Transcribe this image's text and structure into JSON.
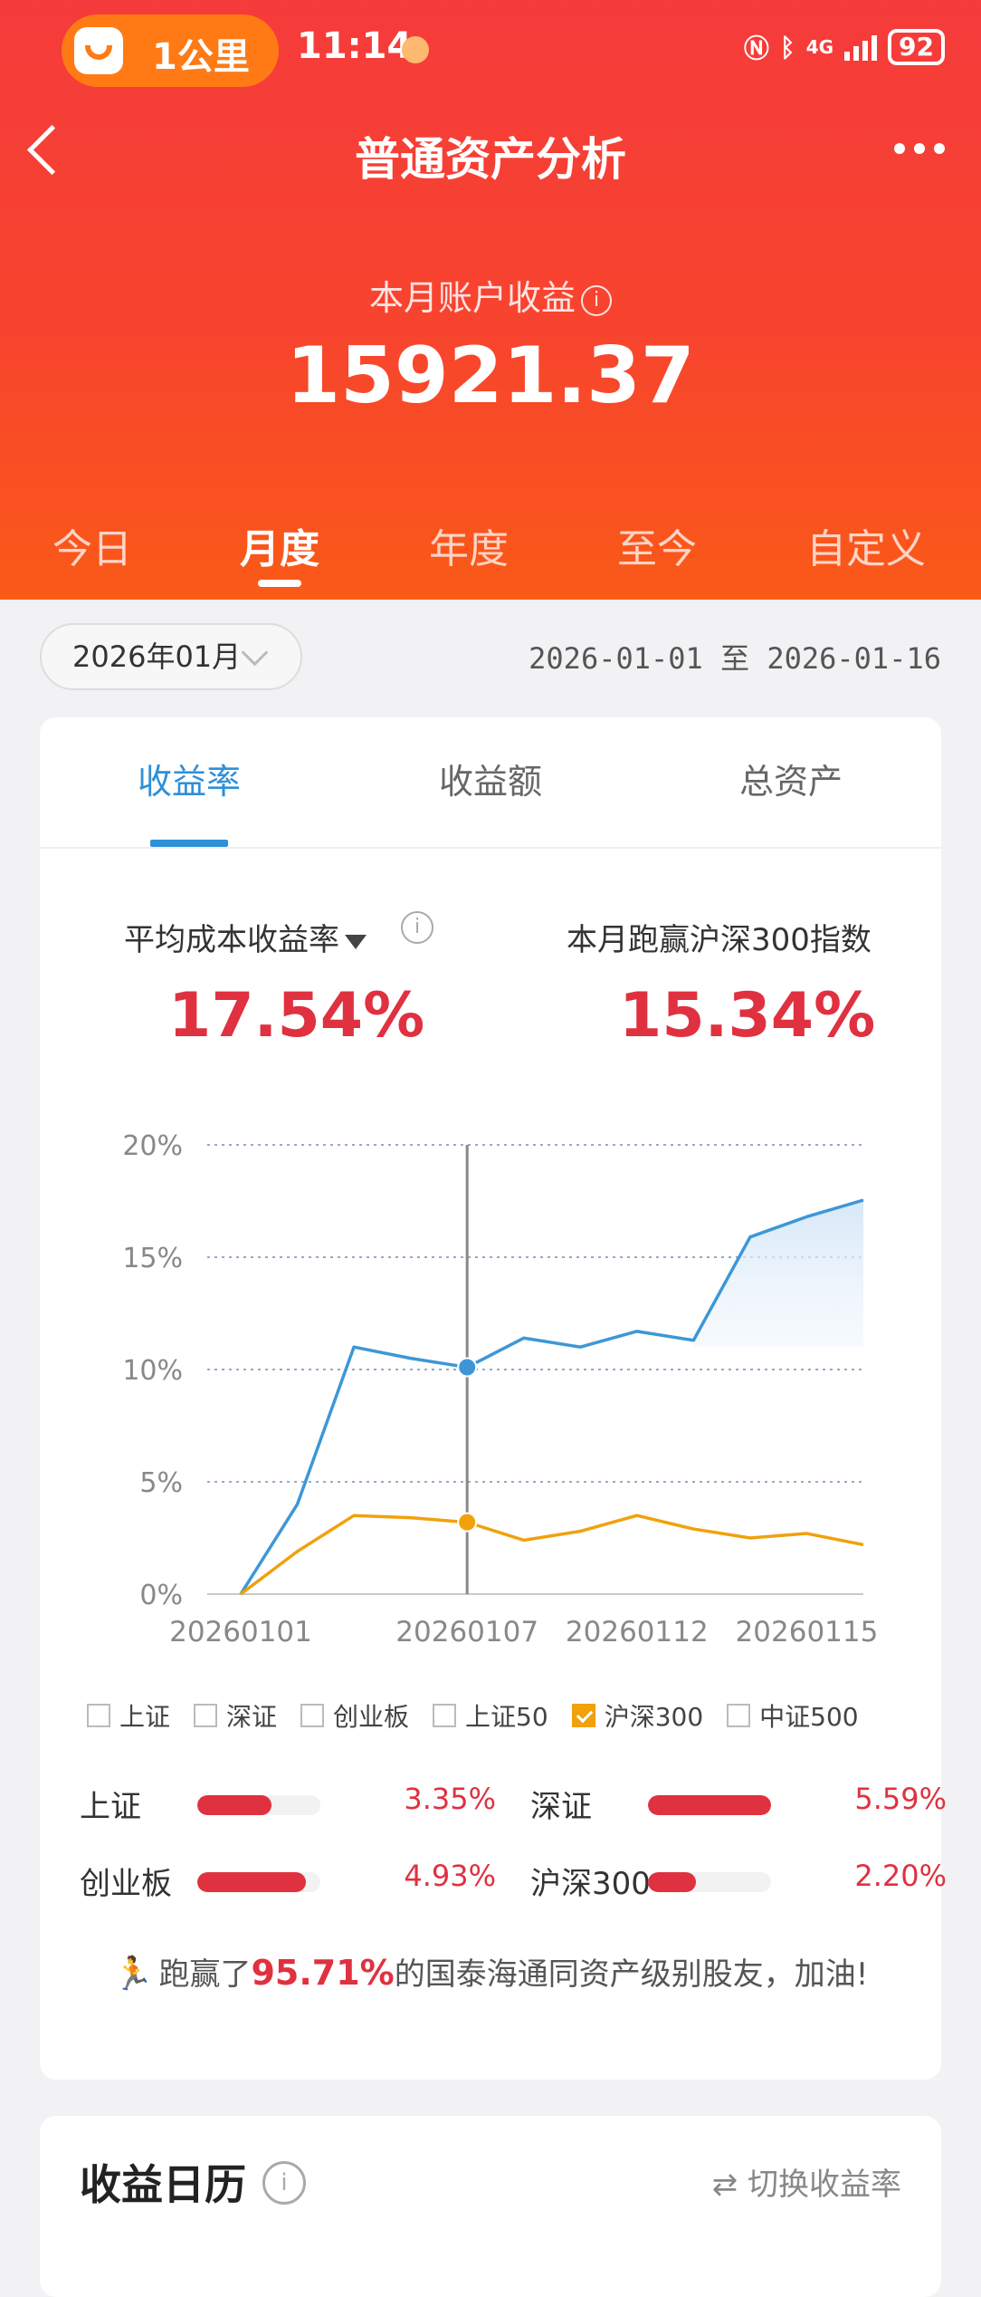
{
  "status_bar": {
    "pill_text": "1公里",
    "time": "11:14",
    "network": "4G",
    "battery": "92"
  },
  "nav": {
    "title": "普通资产分析"
  },
  "summary": {
    "label": "本月账户收益",
    "info": "i",
    "value": "15921.37"
  },
  "periods": [
    "今日",
    "月度",
    "年度",
    "至今",
    "自定义"
  ],
  "active_period": "月度",
  "filter": {
    "month": "2026年01月",
    "range": "2026-01-01 至 2026-01-16"
  },
  "card": {
    "tabs": [
      "收益率",
      "收益额",
      "总资产"
    ],
    "active_tab": "收益率",
    "left_metric": {
      "label": "平均成本收益率",
      "value": "17.54%"
    },
    "right_metric": {
      "label": "本月跑赢沪深300指数",
      "value": "15.34%"
    }
  },
  "chart_data": {
    "type": "line",
    "x": [
      "20260101",
      "20260102",
      "20260105",
      "20260106",
      "20260107",
      "20260108",
      "20260109",
      "20260112",
      "20260113",
      "20260114",
      "20260115",
      "20260116"
    ],
    "x_tick_labels": [
      "20260101",
      "20260107",
      "20260112",
      "20260115"
    ],
    "y_tick_labels": [
      "0%",
      "5%",
      "10%",
      "15%",
      "20%"
    ],
    "ylim": [
      0,
      20
    ],
    "grid": true,
    "series": [
      {
        "values": [
          0,
          4.0,
          11.0,
          10.5,
          10.1,
          11.4,
          11.0,
          11.7,
          11.3,
          15.9,
          16.8,
          17.54
        ],
        "color": "#3d97d6"
      },
      {
        "name": "沪深300",
        "values": [
          0,
          1.9,
          3.5,
          3.4,
          3.2,
          2.4,
          2.8,
          3.5,
          2.9,
          2.5,
          2.7,
          2.2
        ],
        "color": "#f0a10c"
      }
    ],
    "crosshair_index": 4
  },
  "legend": [
    {
      "label": "上证",
      "checked": false
    },
    {
      "label": "深证",
      "checked": false
    },
    {
      "label": "创业板",
      "checked": false
    },
    {
      "label": "上证50",
      "checked": false
    },
    {
      "label": "沪深300",
      "checked": true
    },
    {
      "label": "中证500",
      "checked": false
    }
  ],
  "indices": [
    {
      "name": "上证",
      "value": "3.35%",
      "level": 0.6
    },
    {
      "name": "深证",
      "value": "5.59%",
      "level": 1.0
    },
    {
      "name": "创业板",
      "value": "4.93%",
      "level": 0.88
    },
    {
      "name": "沪深300",
      "value": "2.20%",
      "level": 0.39
    }
  ],
  "beat": {
    "prefix": "跑赢了",
    "pct": "95.71%",
    "suffix": "的国泰海通同资产级别股友，加油!"
  },
  "calendar": {
    "title": "收益日历",
    "switch_label": "切换收益率"
  },
  "colors": {
    "brand_red": "#f53b3b",
    "accent_blue": "#2f8fd8",
    "gain_red": "#e03140",
    "hs300_orange": "#f0a10c"
  }
}
